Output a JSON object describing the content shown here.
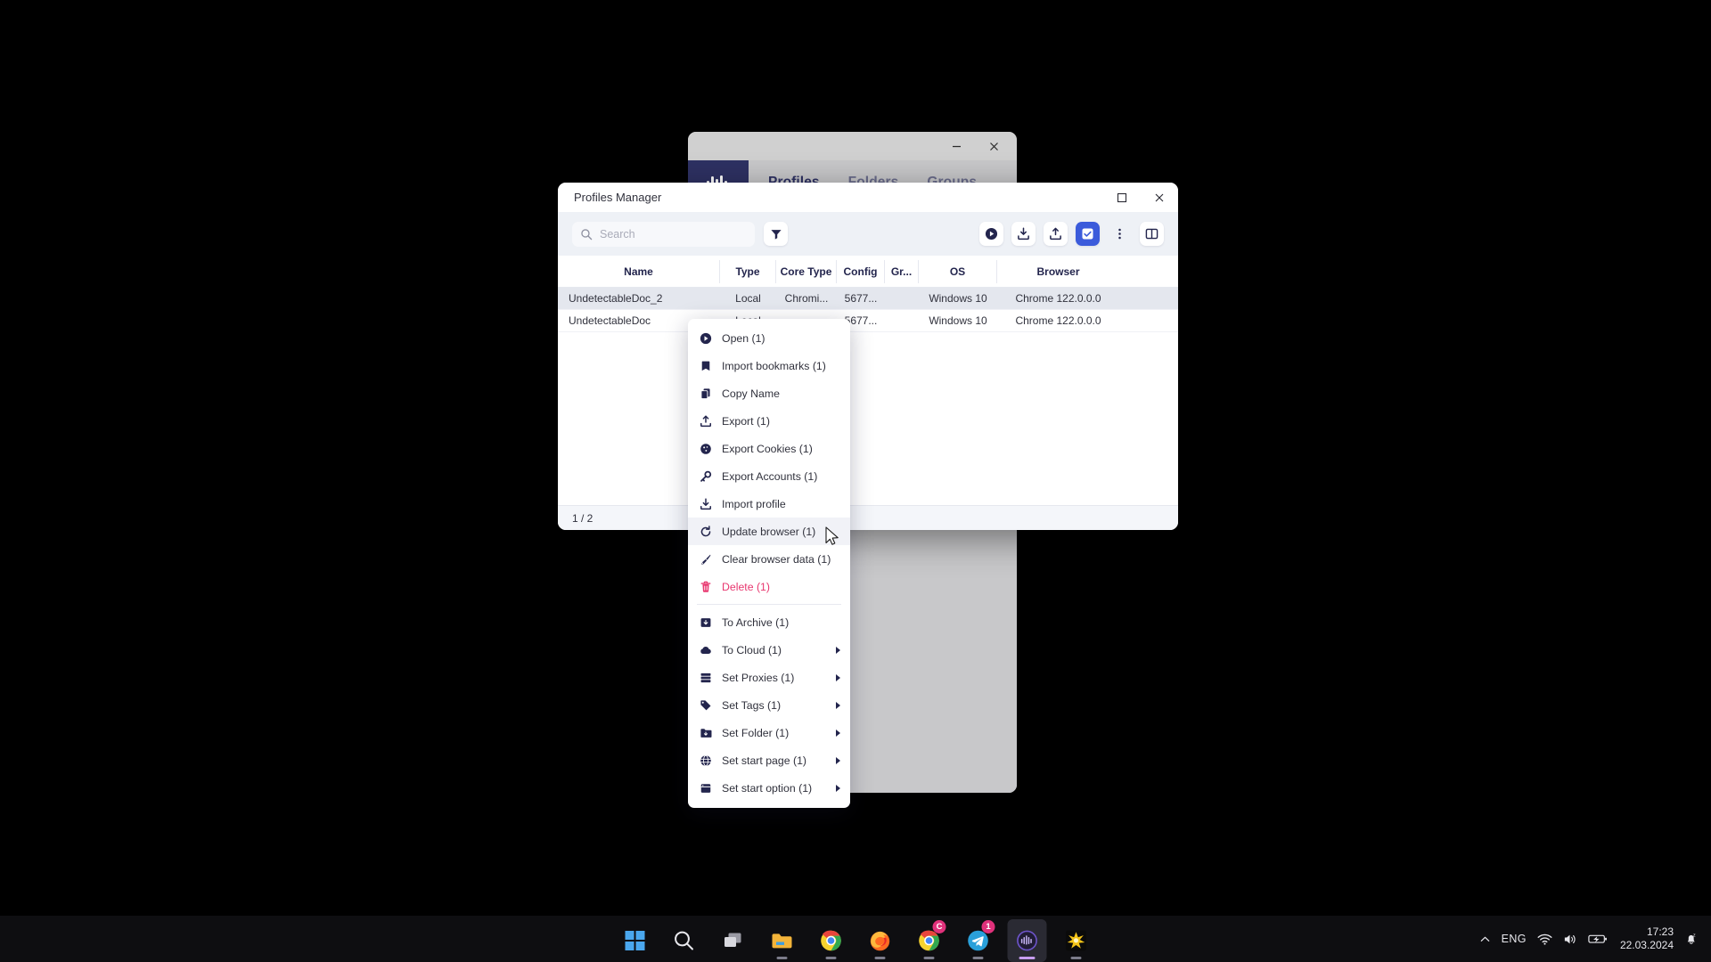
{
  "background_window": {
    "logo_icon": "undetectable-logo-icon",
    "minimize_label": "–",
    "close_label": "✕",
    "tabs": [
      {
        "label": "Profiles",
        "active": true
      },
      {
        "label": "Folders",
        "active": false
      },
      {
        "label": "Groups",
        "active": false
      }
    ]
  },
  "profiles_manager": {
    "title": "Profiles Manager",
    "window_controls": {
      "maximize_icon": "maximize-icon",
      "close_icon": "close-icon"
    },
    "search": {
      "placeholder": "Search",
      "value": "",
      "icon": "search-icon"
    },
    "filter_button": {
      "icon": "filter-funnel-icon"
    },
    "toolbar_buttons": [
      {
        "name": "run-button",
        "icon": "play-circle-icon"
      },
      {
        "name": "import-button",
        "icon": "download-tray-icon"
      },
      {
        "name": "export-button",
        "icon": "upload-tray-icon"
      },
      {
        "name": "select-all-button",
        "icon": "checkbox-checked-icon",
        "accent": true
      },
      {
        "name": "more-options-button",
        "icon": "three-dots-vertical-icon"
      },
      {
        "name": "columns-button",
        "icon": "columns-layout-icon"
      }
    ],
    "table": {
      "columns": [
        "Name",
        "Type",
        "Core Type",
        "Config",
        "Gr...",
        "OS",
        "Browser"
      ],
      "rows": [
        {
          "name": "UndetectableDoc_2",
          "type": "Local",
          "core_type": "Chromi...",
          "config": "5677...",
          "group": "",
          "os": "Windows 10",
          "browser": "Chrome 122.0.0.0",
          "selected": true
        },
        {
          "name": "UndetectableDoc",
          "type": "Local",
          "core_type": "...",
          "config": "5677...",
          "group": "",
          "os": "Windows 10",
          "browser": "Chrome 122.0.0.0",
          "selected": false
        }
      ]
    },
    "status_bar": {
      "page_count": "1 / 2"
    }
  },
  "context_menu": {
    "items": [
      {
        "label": "Open (1)",
        "icon": "play-circle-icon",
        "submenu": false,
        "danger": false,
        "hovered": false
      },
      {
        "label": "Import bookmarks (1)",
        "icon": "bookmark-icon",
        "submenu": false,
        "danger": false,
        "hovered": false
      },
      {
        "label": "Copy Name",
        "icon": "copy-icon",
        "submenu": false,
        "danger": false,
        "hovered": false
      },
      {
        "label": "Export (1)",
        "icon": "upload-tray-icon",
        "submenu": false,
        "danger": false,
        "hovered": false
      },
      {
        "label": "Export Cookies (1)",
        "icon": "cookie-icon",
        "submenu": false,
        "danger": false,
        "hovered": false
      },
      {
        "label": "Export Accounts (1)",
        "icon": "key-icon",
        "submenu": false,
        "danger": false,
        "hovered": false
      },
      {
        "label": "Import profile",
        "icon": "download-tray-icon",
        "submenu": false,
        "danger": false,
        "hovered": false
      },
      {
        "label": "Update browser (1)",
        "icon": "refresh-icon",
        "submenu": false,
        "danger": false,
        "hovered": true
      },
      {
        "label": "Clear browser data (1)",
        "icon": "broom-icon",
        "submenu": false,
        "danger": false,
        "hovered": false
      },
      {
        "label": "Delete (1)",
        "icon": "trash-icon",
        "submenu": false,
        "danger": true,
        "hovered": false
      },
      {
        "separator_after": false,
        "label": "To Archive (1)",
        "icon": "archive-box-icon",
        "submenu": false,
        "danger": false,
        "hovered": false,
        "separator_before": true
      },
      {
        "label": "To Cloud (1)",
        "icon": "cloud-icon",
        "submenu": true,
        "danger": false,
        "hovered": false
      },
      {
        "label": "Set Proxies (1)",
        "icon": "server-stack-icon",
        "submenu": true,
        "danger": false,
        "hovered": false
      },
      {
        "label": "Set Tags (1)",
        "icon": "tag-icon",
        "submenu": true,
        "danger": false,
        "hovered": false
      },
      {
        "label": "Set Folder (1)",
        "icon": "folder-icon",
        "submenu": true,
        "danger": false,
        "hovered": false
      },
      {
        "label": "Set start page (1)",
        "icon": "globe-icon",
        "submenu": true,
        "danger": false,
        "hovered": false
      },
      {
        "label": "Set start option (1)",
        "icon": "window-icon",
        "submenu": true,
        "danger": false,
        "hovered": false
      }
    ]
  },
  "taskbar": {
    "apps": [
      {
        "name": "start-button",
        "icon": "windows-logo-icon",
        "badge": "",
        "running": false,
        "active": false
      },
      {
        "name": "search-button",
        "icon": "search-icon",
        "badge": "",
        "running": false,
        "active": false
      },
      {
        "name": "task-view-button",
        "icon": "task-view-icon",
        "badge": "",
        "running": false,
        "active": false
      },
      {
        "name": "file-explorer",
        "icon": "folder-icon",
        "badge": "",
        "running": true,
        "active": false
      },
      {
        "name": "google-chrome",
        "icon": "chrome-icon",
        "badge": "",
        "running": true,
        "active": false
      },
      {
        "name": "firefox",
        "icon": "firefox-icon",
        "badge": "",
        "running": true,
        "active": false
      },
      {
        "name": "chrome-canary",
        "icon": "chrome-badge-icon",
        "badge": "C",
        "running": true,
        "active": false
      },
      {
        "name": "telegram",
        "icon": "telegram-icon",
        "badge": "1",
        "running": true,
        "active": false
      },
      {
        "name": "undetectable-browser",
        "icon": "undetectable-logo-icon",
        "badge": "",
        "running": true,
        "active": true
      },
      {
        "name": "star-app",
        "icon": "star-burst-icon",
        "badge": "",
        "running": true,
        "active": false
      }
    ],
    "tray": {
      "chevron_icon": "chevron-up-icon",
      "language": "ENG",
      "wifi_icon": "wifi-icon",
      "volume_icon": "volume-icon",
      "battery_icon": "battery-charging-icon",
      "time": "17:23",
      "date": "22.03.2024",
      "notification_icon": "bell-sleep-icon"
    }
  }
}
